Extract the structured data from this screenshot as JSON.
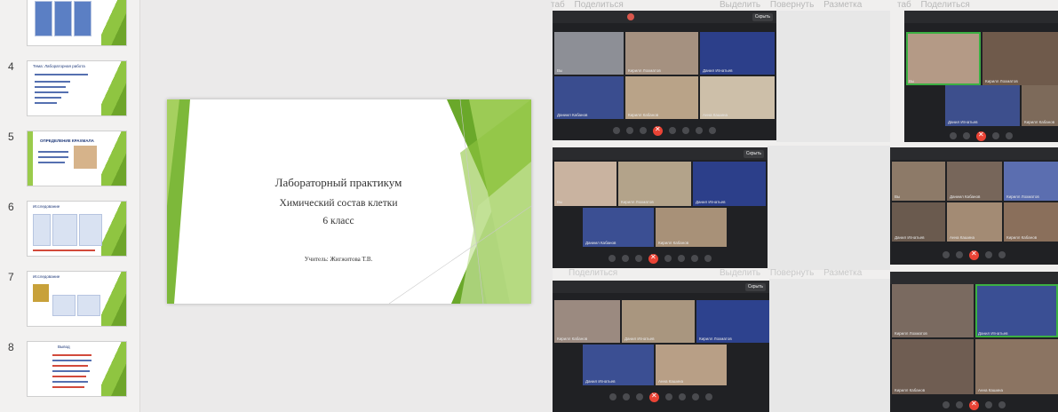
{
  "presentation": {
    "thumbnails": [
      {
        "number": "",
        "title": ""
      },
      {
        "number": "4",
        "title": "Тема: Лабораторная работа"
      },
      {
        "number": "5",
        "title": "ОПРЕДЕЛЕНИЕ КРАХМАЛА"
      },
      {
        "number": "6",
        "title": "Исследование"
      },
      {
        "number": "7",
        "title": "Исследование"
      },
      {
        "number": "8",
        "title": "Вывод"
      }
    ],
    "slide": {
      "title": "Лабораторный практикум",
      "subtitle": "Химический состав клетки",
      "grade": "6 класс",
      "teacher": "Учитель: Жигжитова Т.В."
    },
    "accent_green": "#7db83a",
    "dark_green": "#5a9a22"
  },
  "conference": {
    "menu_top_a": [
      "Выделить",
      "Повернуть",
      "Разметка"
    ],
    "menu_top_b": [
      "таб",
      "Поделиться"
    ],
    "menu_mid_a": [
      "Поделиться"
    ],
    "menu_mid_b": [
      "Выделить",
      "Повернуть",
      "Разметка"
    ],
    "share_label": "Скрыть",
    "window_a_tiles": [
      "Вы",
      "Кирилл Лохматов",
      "Данил Игнатьев",
      "Даниил Кабанов",
      "Кирилл Кабанов",
      "Анна Кашина"
    ],
    "window_b_tiles": [
      "Вы",
      "Кирилл Лохматов",
      "Данил Игнатьев",
      "Кирилл Кабанов"
    ],
    "window_c_tiles": [
      "Вы",
      "Кирилл Лохматов",
      "Данил Игнатьев",
      "Даниил Кабанов",
      "Кирилл Кабанов"
    ],
    "window_d_tiles": [
      "Вы",
      "Даниил Кабанов",
      "Кирилл Лохматов",
      "Данил Игнатьев",
      "Анна Кашина",
      "Кирилл Кабанов"
    ],
    "window_e_tiles": [
      "Кирилл Кабанов",
      "Данил Игнатьев",
      "Кирилл Лохматов",
      "Данил Игнатьев",
      "Анна Кашина"
    ],
    "window_f_tiles": [
      "Кирилл Лохматов",
      "Данил Игнатьев",
      "Кирилл Кабанов",
      "Анна Кашина"
    ],
    "call_color_end": "#ea4335",
    "speaking_color": "#3cb043"
  }
}
